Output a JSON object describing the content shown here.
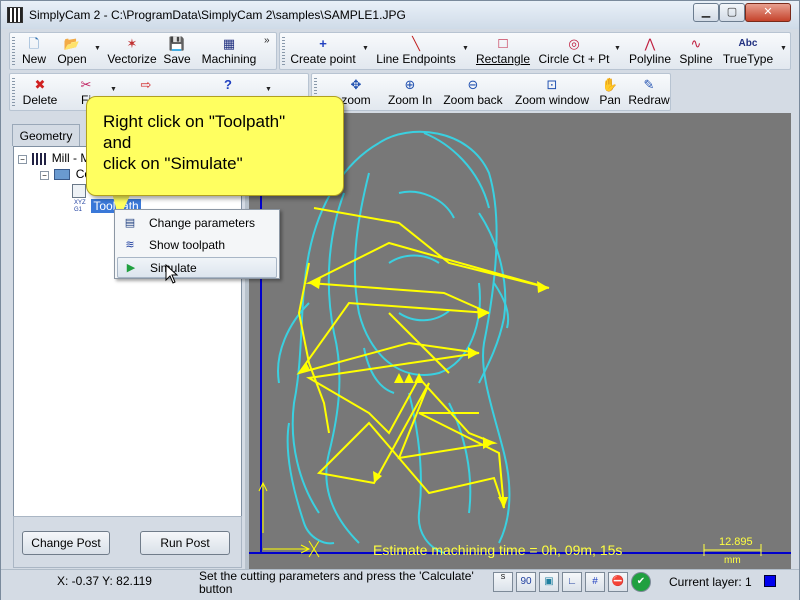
{
  "window": {
    "title": "SimplyCam 2 - C:\\ProgramData\\SimplyCam 2\\samples\\SAMPLE1.JPG",
    "minimize": "▁",
    "maximize": "▢",
    "close": "✕"
  },
  "toolbar_main": [
    {
      "label": "New",
      "icon": "new-file-icon",
      "glyph": "🗋"
    },
    {
      "label": "Open",
      "icon": "open-folder-icon",
      "glyph": "📂"
    },
    {
      "label": "Vectorize",
      "icon": "vectorize-icon",
      "glyph": "✶"
    },
    {
      "label": "Save",
      "icon": "save-icon",
      "glyph": "💾"
    },
    {
      "label": "Machining",
      "icon": "machining-icon",
      "glyph": "▦"
    }
  ],
  "toolbar_draw": [
    {
      "label": "Create point",
      "icon": "point-icon",
      "glyph": "+"
    },
    {
      "label": "Line Endpoints",
      "icon": "line-icon",
      "glyph": "╲"
    },
    {
      "label": "Rectangle",
      "icon": "rectangle-icon",
      "glyph": "□"
    },
    {
      "label": "Circle Ct + Pt",
      "icon": "circle-icon",
      "glyph": "◎"
    },
    {
      "label": "Polyline",
      "icon": "polyline-icon",
      "glyph": "⋀"
    },
    {
      "label": "Spline",
      "icon": "spline-icon",
      "glyph": "∿"
    },
    {
      "label": "TrueType",
      "icon": "truetype-icon",
      "glyph": "Abc"
    }
  ],
  "toolbar_edit": [
    {
      "label": "Delete",
      "icon": "delete-icon",
      "glyph": "✖"
    },
    {
      "label": "Fi",
      "icon": "trim-icon",
      "glyph": "✂"
    }
  ],
  "toolbar_view": [
    {
      "label": "zoom",
      "icon": "fit-zoom-icon",
      "glyph": "✥"
    },
    {
      "label": "Zoom In",
      "icon": "zoom-in-icon",
      "glyph": "⊕"
    },
    {
      "label": "Zoom back",
      "icon": "zoom-back-icon",
      "glyph": "⊖"
    },
    {
      "label": "Zoom window",
      "icon": "zoom-window-icon",
      "glyph": "⊡"
    },
    {
      "label": "Pan",
      "icon": "pan-hand-icon",
      "glyph": "✋"
    },
    {
      "label": "Redraw",
      "icon": "redraw-icon",
      "glyph": "✎"
    }
  ],
  "left_panel": {
    "tab": "Geometry",
    "tree": {
      "root": "Mill - M",
      "child": "Co",
      "toolpath": "Toolpath"
    },
    "change_post": "Change Post",
    "run_post": "Run Post"
  },
  "context_menu": [
    {
      "label": "Change parameters",
      "icon": "parameters-icon",
      "glyph": "▤"
    },
    {
      "label": "Show toolpath",
      "icon": "toolpath-icon",
      "glyph": "≋"
    },
    {
      "label": "Simulate",
      "icon": "simulate-icon",
      "glyph": "▶"
    }
  ],
  "callout": {
    "text": "Right click on \"Toolpath\"\nand\nclick on \"Simulate\""
  },
  "canvas": {
    "estimate": "Estimate machining time = 0h, 09m, 15s",
    "scale_value": "12.895",
    "scale_unit": "mm",
    "colors": {
      "background": "#787878",
      "contour": "#3ad0e0",
      "toolpath": "#ffff00",
      "axis": "#0000cc"
    }
  },
  "status": {
    "coords": "X: -0.37 Y: 82.119",
    "hint": "Set the cutting parameters and press the 'Calculate' button",
    "icons": [
      {
        "name": "snap-off-icon",
        "glyph": "S"
      },
      {
        "name": "angle-90-icon",
        "glyph": "90"
      },
      {
        "name": "snap-grid-icon",
        "glyph": "▣"
      },
      {
        "name": "ortho-icon",
        "glyph": "∟"
      },
      {
        "name": "grid-icon",
        "glyph": "#"
      },
      {
        "name": "stop-icon",
        "glyph": "⛔"
      },
      {
        "name": "ok-check-icon",
        "glyph": "✔"
      }
    ],
    "layer": "Current layer: 1"
  }
}
